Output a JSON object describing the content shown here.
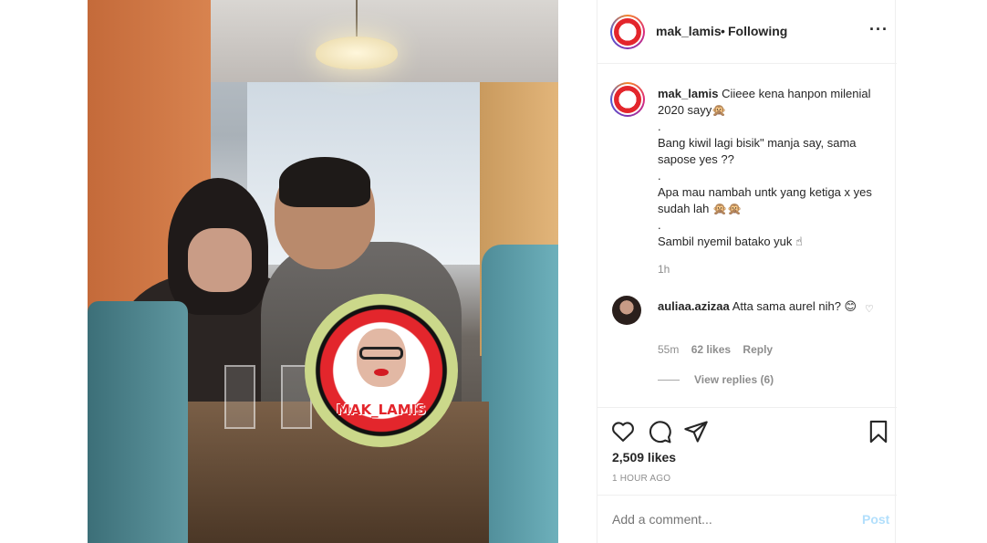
{
  "header": {
    "username": "mak_lamis",
    "separator": "•",
    "follow_status": "Following",
    "more_icon": "more-horizontal-icon",
    "more_glyph": "···"
  },
  "watermark": {
    "text": "MAK_LAMIS"
  },
  "caption": {
    "username": "mak_lamis",
    "lines": [
      "Ciieee kena hanpon milenial 2020 sayy🙊",
      ".",
      "Bang kiwil lagi bisik\" manja say, sama sapose yes ??",
      ".",
      "Apa mau nambah untk yang ketiga x yes sudah lah 🙊🙊",
      ".",
      "Sambil nyemil batako yuk ☝"
    ],
    "time": "1h"
  },
  "comment": {
    "username": "auliaa.azizaa",
    "text": "Atta sama aurel nih? 😊",
    "time": "55m",
    "likes": "62 likes",
    "reply_label": "Reply",
    "view_replies": "View replies (6)",
    "heart_glyph": "♡"
  },
  "actions": {
    "icons": [
      "heart-icon",
      "comment-icon",
      "share-icon",
      "bookmark-icon"
    ],
    "likes_count": "2,509 likes",
    "ago": "1 HOUR AGO"
  },
  "add_comment": {
    "placeholder": "Add a comment...",
    "post_label": "Post",
    "post_color": "#b2dffc"
  }
}
